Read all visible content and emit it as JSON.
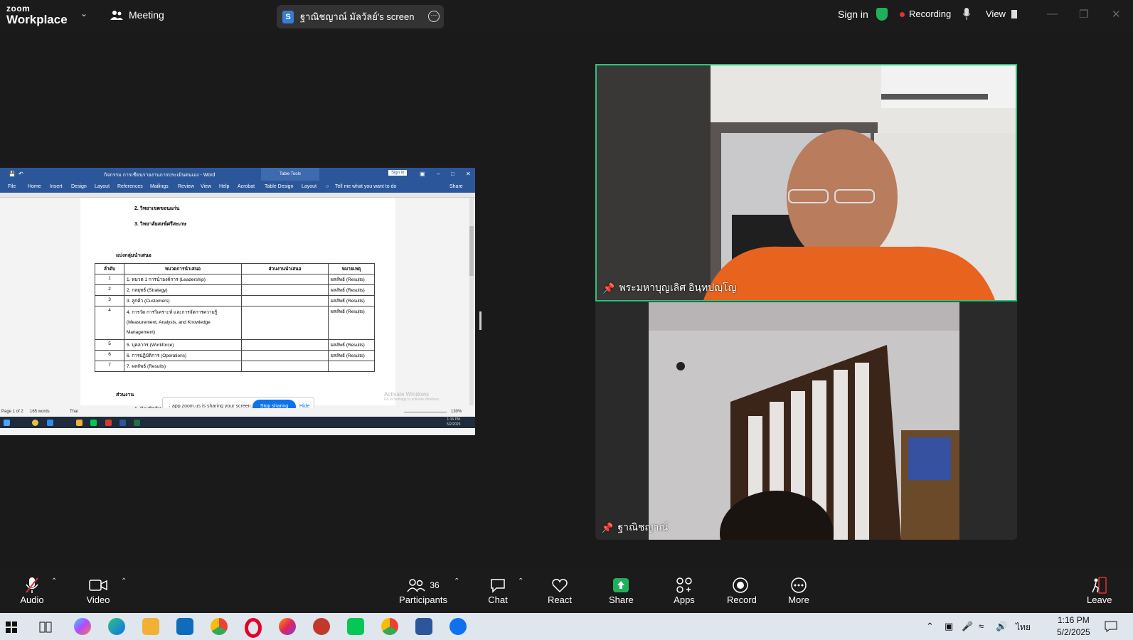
{
  "topbar": {
    "logo_top": "zoom",
    "logo_bottom": "Workplace",
    "meeting": "Meeting",
    "screen_label": "ฐาณิชญาณ์ มัลวัลย์'s screen",
    "sign_in": "Sign in",
    "recording": "Recording",
    "view": "View"
  },
  "word": {
    "title": "กิจกรรม การเขียนรายงานการประเมินตนเอง  -  Word",
    "table_tools": "Table Tools",
    "sign_in": "Sign in",
    "tabs": [
      "File",
      "Home",
      "Insert",
      "Design",
      "Layout",
      "References",
      "Mailings",
      "Review",
      "View",
      "Help",
      "Acrobat",
      "Table Design",
      "Layout"
    ],
    "tell_me": "Tell me what you want to do",
    "share": "Share",
    "line1": "2. วิทยาเขตขอนแก่น",
    "line2": "3. วิทยาลัยสงฆ์ศรีสะเกษ",
    "group_heading": "แบ่งกลุ่มนำเสนอ",
    "table": {
      "headers": [
        "ลำดับ",
        "หมวดการนำเสนอ",
        "ส่วนงานนำเสนอ",
        "หมายเหตุ"
      ],
      "rows": [
        [
          "1",
          "1. หมวด 1 การนำองค์การ (Leadership)",
          "",
          "ผลลัพธ์ (Results)"
        ],
        [
          "2",
          "2. กลยุทธ์ (Strategy)",
          "",
          "ผลลัพธ์ (Results)"
        ],
        [
          "3",
          "3. ลูกค้า (Customers)",
          "",
          "ผลลัพธ์ (Results)"
        ],
        [
          "4",
          "4. การวัด การวิเคราะห์ และการจัดการความรู้ (Measurement, Analysis, and Knowledge Management)",
          "",
          "ผลลัพธ์ (Results)"
        ],
        [
          "5",
          "5. บุคลากร (Workforce)",
          "",
          "ผลลัพธ์ (Results)"
        ],
        [
          "6",
          "6. การปฏิบัติการ (Operations)",
          "",
          "ผลลัพธ์ (Results)"
        ],
        [
          "7",
          "7. ผลลัพธ์ (Results)",
          "",
          ""
        ]
      ]
    },
    "section_heading": "ส่วนงาน",
    "line3": "1. บัณฑิตวิท",
    "sharing_msg": "app.zoom.us is sharing your screen.",
    "stop_sharing": "Stop sharing",
    "hide": "Hide",
    "activate": "Activate Windows",
    "activate_sub": "Go to Settings to activate Windows.",
    "status_page": "Page 1 of 2",
    "status_words": "165 words",
    "status_lang": "Thai",
    "zoom": "130%",
    "mini_time": "1:16 PM",
    "mini_date": "5/2/2025"
  },
  "videos": {
    "v1_name": "พระมหาบุญเลิศ อินฺทปญฺโญ",
    "v2_name": "ฐาณิชญาณ์"
  },
  "toolbar": {
    "audio": "Audio",
    "video": "Video",
    "participants": "Participants",
    "participants_count": "36",
    "chat": "Chat",
    "react": "React",
    "share": "Share",
    "apps": "Apps",
    "record": "Record",
    "more": "More",
    "leave": "Leave"
  },
  "taskbar": {
    "lang": "ไทย",
    "time": "1:16 PM",
    "date": "5/2/2025"
  },
  "colors": {
    "share_green": "#1fb15a",
    "speaker_border": "#2ec27e",
    "word_blue": "#2b579a",
    "zoom_blue": "#0e72ed"
  }
}
